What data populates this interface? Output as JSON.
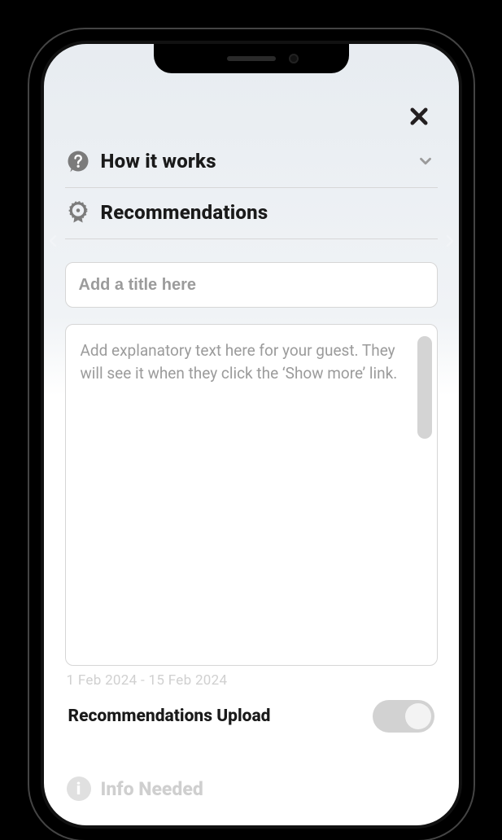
{
  "sections": {
    "how_it_works": {
      "title": "How it works"
    },
    "recommendations": {
      "title": "Recommendations"
    }
  },
  "form": {
    "title_placeholder": "Add a title here",
    "description_placeholder": "Add explanatory text here for your guest. They will see it when they click the ‘Show more’ link."
  },
  "ghost_dates": "1 Feb 2024 - 15 Feb 2024",
  "upload_toggle": {
    "label": "Recommendations Upload",
    "on": false
  },
  "ghost_section": {
    "label": "Info Needed"
  }
}
